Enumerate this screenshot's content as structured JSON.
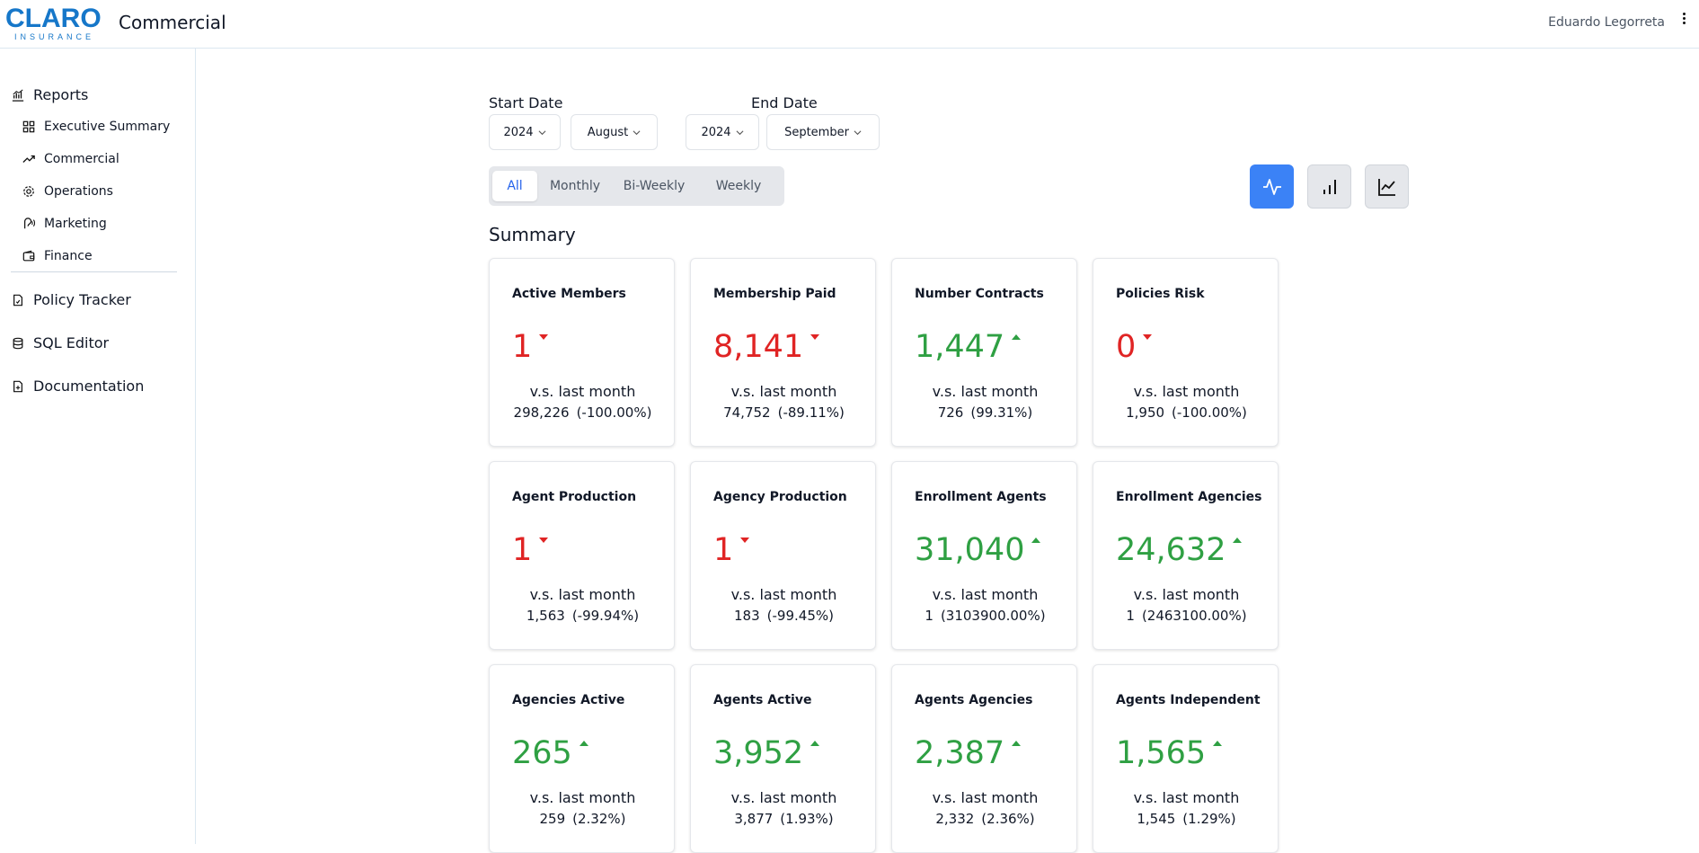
{
  "header": {
    "logo_main": "CLARO",
    "logo_sub": "INSURANCE",
    "app_title": "Commercial",
    "user_name": "Eduardo Legorreta"
  },
  "sidebar": {
    "reports_label": "Reports",
    "items": [
      {
        "label": "Executive Summary",
        "icon": "grid-icon"
      },
      {
        "label": "Commercial",
        "icon": "trending-up-icon"
      },
      {
        "label": "Operations",
        "icon": "gear-icon"
      },
      {
        "label": "Marketing",
        "icon": "megaphone-icon"
      },
      {
        "label": "Finance",
        "icon": "wallet-icon"
      }
    ],
    "policy_tracker": "Policy Tracker",
    "sql_editor": "SQL Editor",
    "documentation": "Documentation"
  },
  "filters": {
    "start_label": "Start Date",
    "end_label": "End Date",
    "start_year": "2024",
    "start_month": "August",
    "end_year": "2024",
    "end_month": "September"
  },
  "period_tabs": [
    "All",
    "Monthly",
    "Bi-Weekly",
    "Weekly"
  ],
  "period_active": "All",
  "view_modes": [
    "pulse-chart-icon",
    "bar-chart-icon",
    "line-chart-icon"
  ],
  "view_active": "pulse-chart-icon",
  "summary_title": "Summary",
  "colors": {
    "accent": "#3b82f6",
    "negative": "#e02424",
    "positive": "#2fa043"
  },
  "cards": [
    {
      "title": "Active Members",
      "value": "1",
      "trend": "down",
      "vs": "v.s. last month",
      "prev": "298,226",
      "pct": "(-100.00%)"
    },
    {
      "title": "Membership Paid",
      "value": "8,141",
      "trend": "down",
      "vs": "v.s. last month",
      "prev": "74,752",
      "pct": "(-89.11%)"
    },
    {
      "title": "Number Contracts",
      "value": "1,447",
      "trend": "up",
      "vs": "v.s. last month",
      "prev": "726",
      "pct": "(99.31%)"
    },
    {
      "title": "Policies Risk",
      "value": "0",
      "trend": "down",
      "vs": "v.s. last month",
      "prev": "1,950",
      "pct": "(-100.00%)"
    },
    {
      "title": "Agent Production",
      "value": "1",
      "trend": "down",
      "vs": "v.s. last month",
      "prev": "1,563",
      "pct": "(-99.94%)"
    },
    {
      "title": "Agency Production",
      "value": "1",
      "trend": "down",
      "vs": "v.s. last month",
      "prev": "183",
      "pct": "(-99.45%)"
    },
    {
      "title": "Enrollment Agents",
      "value": "31,040",
      "trend": "up",
      "vs": "v.s. last month",
      "prev": "1",
      "pct": "(3103900.00%)"
    },
    {
      "title": "Enrollment Agencies",
      "value": "24,632",
      "trend": "up",
      "vs": "v.s. last month",
      "prev": "1",
      "pct": "(2463100.00%)"
    },
    {
      "title": "Agencies Active",
      "value": "265",
      "trend": "up",
      "vs": "v.s. last month",
      "prev": "259",
      "pct": "(2.32%)"
    },
    {
      "title": "Agents Active",
      "value": "3,952",
      "trend": "up",
      "vs": "v.s. last month",
      "prev": "3,877",
      "pct": "(1.93%)"
    },
    {
      "title": "Agents Agencies",
      "value": "2,387",
      "trend": "up",
      "vs": "v.s. last month",
      "prev": "2,332",
      "pct": "(2.36%)"
    },
    {
      "title": "Agents Independent",
      "value": "1,565",
      "trend": "up",
      "vs": "v.s. last month",
      "prev": "1,545",
      "pct": "(1.29%)"
    }
  ]
}
